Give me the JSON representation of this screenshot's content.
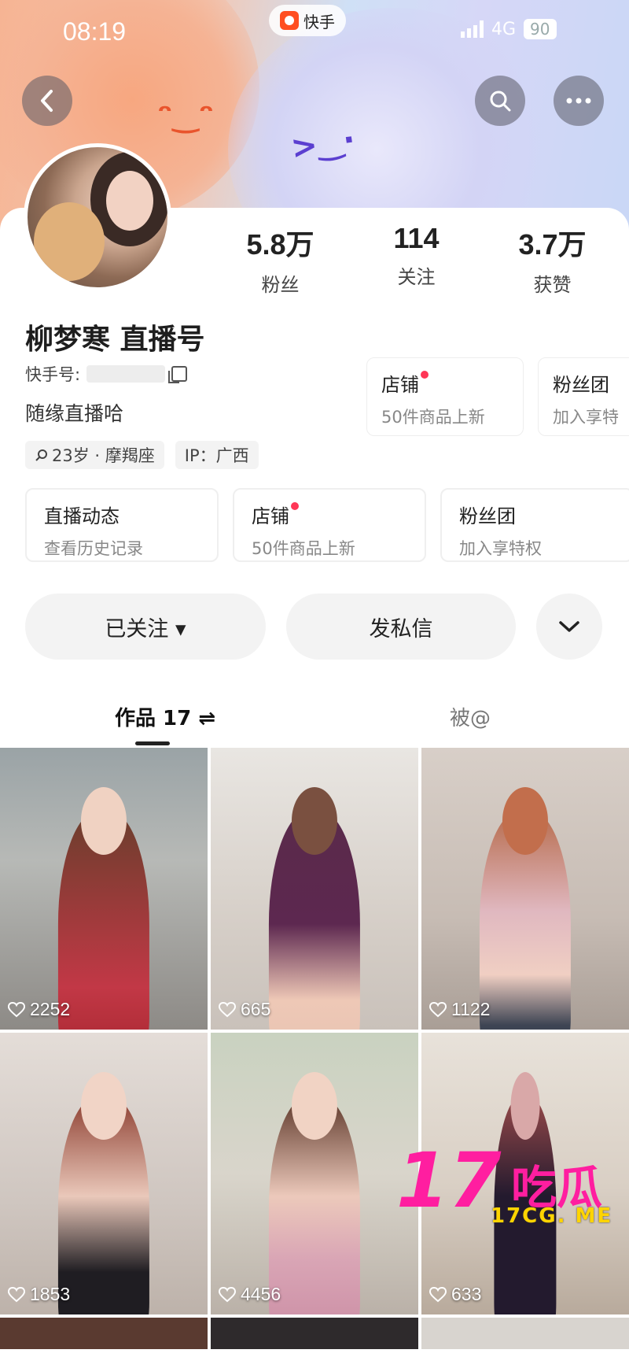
{
  "status_bar": {
    "time": "08:19",
    "app_name": "快手",
    "network": "4G",
    "battery": "90"
  },
  "profile": {
    "name": "柳梦寒 直播号",
    "kuaishou_id_label": "快手号:",
    "bio": "随缘直播哈",
    "tags": [
      "23岁 · 摩羯座",
      "IP：广西"
    ],
    "stats": [
      {
        "value": "5.8万",
        "label": "粉丝"
      },
      {
        "value": "114",
        "label": "关注"
      },
      {
        "value": "3.7万",
        "label": "获赞"
      }
    ]
  },
  "overlay_cards": [
    {
      "title": "店铺",
      "sub": "50件商品上新"
    },
    {
      "title": "粉丝团",
      "sub": "加入享特"
    }
  ],
  "features": [
    {
      "title": "直播动态",
      "sub": "查看历史记录"
    },
    {
      "title": "店铺",
      "sub": "50件商品上新"
    },
    {
      "title": "粉丝团",
      "sub": "加入享特权"
    }
  ],
  "actions": {
    "follow": "已关注 ▾",
    "message": "发私信"
  },
  "tabs": {
    "works": "作品 17 ⇌",
    "mentions": "被@"
  },
  "posts": [
    {
      "likes": "2252"
    },
    {
      "likes": "665"
    },
    {
      "likes": "1122"
    },
    {
      "likes": "1853"
    },
    {
      "likes": "4456"
    },
    {
      "likes": "633"
    }
  ],
  "watermark": {
    "number": "17",
    "chars": "吃瓜",
    "url": "17CG. ME"
  },
  "colors": {
    "accent_red": "#ff3656",
    "watermark_pink": "#ff1ea0",
    "watermark_yellow": "#ffd400"
  }
}
